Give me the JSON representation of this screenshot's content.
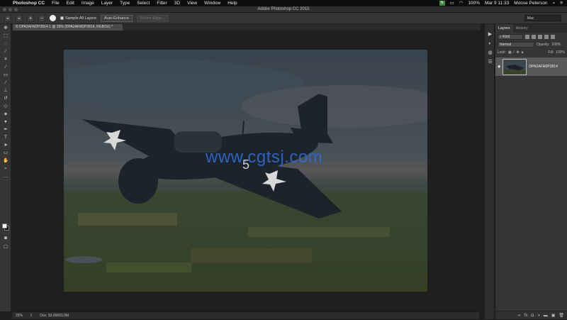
{
  "menubar": {
    "app": "Photoshop CC",
    "items": [
      "File",
      "Edit",
      "Image",
      "Layer",
      "Type",
      "Select",
      "Filter",
      "3D",
      "View",
      "Window",
      "Help"
    ],
    "battery": "100%",
    "datetime": "Mar 9  11:33",
    "user": "Moose Peterson"
  },
  "titlebar": {
    "title": "Adobe Photoshop CC 2015"
  },
  "options": {
    "sample_all_layers": "Sample All Layers",
    "auto_enhance": "Auto-Enhance",
    "refine_edge": "Refine Edge...",
    "workspace": "Mac"
  },
  "document": {
    "tab": "© DPA2AFM2P2814-1 @ 25% (DPA2AFM2P2814, RGB/16) *",
    "zoom": "25%",
    "doc_size": "Doc: 93.9M/93.9M",
    "watermark": "www.cgtsj.com"
  },
  "layers_panel": {
    "tabs": [
      "Layers",
      "History"
    ],
    "filter_kind": "Kind",
    "blend_mode": "Normal",
    "opacity_label": "Opacity:",
    "opacity_value": "100%",
    "lock_label": "Lock:",
    "fill_label": "Fill:",
    "fill_value": "100%",
    "layer_name": "DPA2AFM2P2814"
  }
}
